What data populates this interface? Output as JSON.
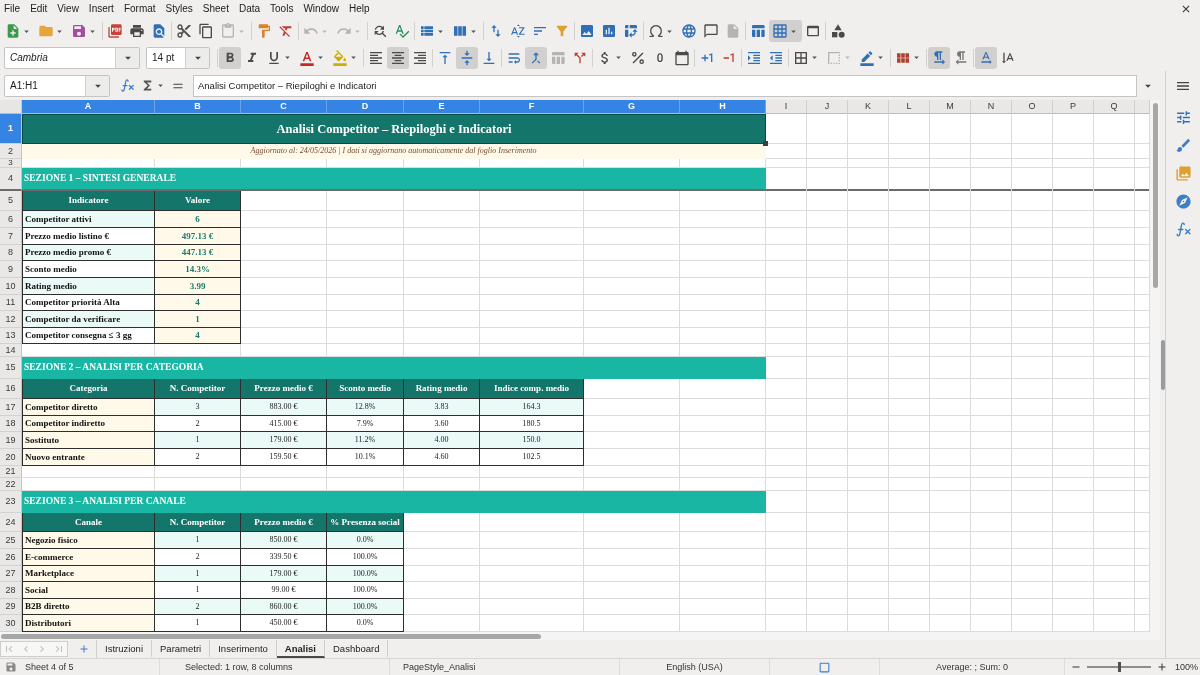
{
  "menu_bar": {
    "items": [
      "File",
      "Edit",
      "View",
      "Insert",
      "Format",
      "Styles",
      "Sheet",
      "Data",
      "Tools",
      "Window",
      "Help"
    ]
  },
  "standard_toolbar": [
    {
      "pressed": false,
      "disabled": false
    },
    {
      "pressed": false,
      "disabled": false
    },
    {
      "pressed": false,
      "disabled": false
    },
    {
      "pressed": false,
      "disabled": false
    },
    {
      "pressed": false,
      "disabled": false
    },
    {
      "pressed": false,
      "disabled": false
    },
    {
      "pressed": false,
      "disabled": false
    },
    {
      "pressed": false,
      "disabled": false
    },
    {
      "pressed": false,
      "disabled": true
    },
    {
      "pressed": false,
      "disabled": false
    },
    {
      "pressed": false,
      "disabled": false
    },
    {
      "pressed": false,
      "disabled": true
    },
    {
      "pressed": false,
      "disabled": true
    },
    {
      "pressed": false,
      "disabled": false
    },
    {
      "pressed": false,
      "disabled": false
    },
    {
      "pressed": false,
      "disabled": false
    },
    {
      "pressed": false,
      "disabled": false
    },
    {
      "pressed": false,
      "disabled": false
    },
    {
      "pressed": false,
      "disabled": false
    },
    {
      "pressed": false,
      "disabled": false
    },
    {
      "pressed": false,
      "disabled": false
    },
    {
      "pressed": false,
      "disabled": false
    },
    {
      "pressed": false,
      "disabled": false
    },
    {
      "pressed": false,
      "disabled": false
    },
    {
      "pressed": false,
      "disabled": false
    },
    {
      "pressed": false,
      "disabled": false
    },
    {
      "pressed": false,
      "disabled": false
    },
    {
      "pressed": false,
      "disabled": true
    },
    {
      "pressed": false,
      "disabled": false
    },
    {
      "pressed": true,
      "disabled": false
    },
    {
      "pressed": false,
      "disabled": false
    },
    {
      "pressed": false,
      "disabled": false
    }
  ],
  "formatting_toolbar": {
    "font_name": "Cambria",
    "font_size": "14 pt",
    "buttons": [
      {
        "pressed": true,
        "disabled": false
      },
      {
        "pressed": false,
        "disabled": false
      },
      {
        "pressed": false,
        "disabled": false
      },
      {
        "pressed": false,
        "disabled": false
      },
      {
        "pressed": false,
        "disabled": false
      },
      {
        "pressed": false,
        "disabled": false
      },
      {
        "pressed": true,
        "disabled": false
      },
      {
        "pressed": false,
        "disabled": false
      },
      {
        "pressed": false,
        "disabled": false
      },
      {
        "pressed": true,
        "disabled": false
      },
      {
        "pressed": false,
        "disabled": false
      },
      {
        "pressed": false,
        "disabled": false
      },
      {
        "pressed": true,
        "disabled": false
      },
      {
        "pressed": false,
        "disabled": true
      },
      {
        "pressed": false,
        "disabled": false
      },
      {
        "pressed": false,
        "disabled": false
      },
      {
        "pressed": false,
        "disabled": false
      },
      {
        "pressed": false,
        "disabled": false
      },
      {
        "pressed": false,
        "disabled": false
      },
      {
        "pressed": false,
        "disabled": false
      },
      {
        "pressed": false,
        "disabled": false
      },
      {
        "pressed": false,
        "disabled": false
      },
      {
        "pressed": false,
        "disabled": false
      },
      {
        "pressed": false,
        "disabled": false
      },
      {
        "pressed": false,
        "disabled": true
      },
      {
        "pressed": false,
        "disabled": false
      },
      {
        "pressed": false,
        "disabled": false
      },
      {
        "pressed": true,
        "disabled": false
      },
      {
        "pressed": false,
        "disabled": false
      },
      {
        "pressed": true,
        "disabled": false
      },
      {
        "pressed": false,
        "disabled": false
      }
    ]
  },
  "formula_bar": {
    "name_box": "A1:H1",
    "formula": "Analisi Competitor – Riepiloghi e Indicatori"
  },
  "sheet": {
    "column_headers": [
      {
        "label": "A",
        "selected": true
      },
      {
        "label": "B",
        "selected": true
      },
      {
        "label": "C",
        "selected": true
      },
      {
        "label": "D",
        "selected": true
      },
      {
        "label": "E",
        "selected": true
      },
      {
        "label": "F",
        "selected": true
      },
      {
        "label": "G",
        "selected": true
      },
      {
        "label": "H",
        "selected": true
      },
      {
        "label": "I",
        "selected": false
      },
      {
        "label": "J",
        "selected": false
      },
      {
        "label": "K",
        "selected": false
      },
      {
        "label": "L",
        "selected": false
      },
      {
        "label": "M",
        "selected": false
      },
      {
        "label": "N",
        "selected": false
      },
      {
        "label": "O",
        "selected": false
      },
      {
        "label": "P",
        "selected": false
      },
      {
        "label": "Q",
        "selected": false
      }
    ],
    "row_headers": [
      {
        "label": "1",
        "selected": true
      },
      {
        "label": "2",
        "selected": false
      },
      {
        "label": "3",
        "selected": false
      },
      {
        "label": "4",
        "selected": false
      },
      {
        "label": "5",
        "selected": false
      },
      {
        "label": "6",
        "selected": false
      },
      {
        "label": "7",
        "selected": false
      },
      {
        "label": "8",
        "selected": false
      },
      {
        "label": "9",
        "selected": false
      },
      {
        "label": "10",
        "selected": false
      },
      {
        "label": "11",
        "selected": false
      },
      {
        "label": "12",
        "selected": false
      },
      {
        "label": "13",
        "selected": false
      },
      {
        "label": "14",
        "selected": false
      },
      {
        "label": "15",
        "selected": false
      },
      {
        "label": "16",
        "selected": false
      },
      {
        "label": "17",
        "selected": false
      },
      {
        "label": "18",
        "selected": false
      },
      {
        "label": "19",
        "selected": false
      },
      {
        "label": "20",
        "selected": false
      },
      {
        "label": "21",
        "selected": false
      },
      {
        "label": "22",
        "selected": false
      },
      {
        "label": "23",
        "selected": false
      },
      {
        "label": "24",
        "selected": false
      },
      {
        "label": "25",
        "selected": false
      },
      {
        "label": "26",
        "selected": false
      },
      {
        "label": "27",
        "selected": false
      },
      {
        "label": "28",
        "selected": false
      },
      {
        "label": "29",
        "selected": false
      },
      {
        "label": "30",
        "selected": false
      }
    ],
    "title": "Analisi Competitor – Riepiloghi e Indicatori",
    "subtitle": "Aggiornato al: 24/05/2026 | I dati si aggiornano automaticamente dal foglio Inserimento",
    "sections": [
      {
        "kind": "summary",
        "title": "SEZIONE 1 – SINTESI GENERALE",
        "columns": [
          "Indicatore",
          "Valore"
        ],
        "rows": [
          [
            "Competitor attivi",
            "6"
          ],
          [
            "Prezzo medio listino €",
            "497.13 €"
          ],
          [
            "Prezzo medio promo €",
            "447.13 €"
          ],
          [
            "Sconto medio",
            "14.3%"
          ],
          [
            "Rating medio",
            "3.99"
          ],
          [
            "Competitor priorità Alta",
            "4"
          ],
          [
            "Competitor da verificare",
            "1"
          ],
          [
            "Competitor consegna ≤ 3 gg",
            "4"
          ]
        ]
      },
      {
        "kind": "breakdown",
        "title": "SEZIONE 2 – ANALISI PER CATEGORIA",
        "columns": [
          "Categoria",
          "N. Competitor",
          "Prezzo medio €",
          "Sconto medio",
          "Rating medio",
          "Indice comp. medio"
        ],
        "rows": [
          [
            "Competitor diretto",
            "3",
            "883.00 €",
            "12.8%",
            "3.83",
            "164.3"
          ],
          [
            "Competitor indiretto",
            "2",
            "415.00 €",
            "7.9%",
            "3.60",
            "180.5"
          ],
          [
            "Sostituto",
            "1",
            "179.00 €",
            "11.2%",
            "4.00",
            "150.0"
          ],
          [
            "Nuovo entrante",
            "2",
            "159.50 €",
            "10.1%",
            "4.60",
            "102.5"
          ]
        ]
      },
      {
        "kind": "breakdown",
        "title": "SEZIONE 3 – ANALISI PER CANALE",
        "columns": [
          "Canale",
          "N. Competitor",
          "Prezzo medio €",
          "% Presenza social"
        ],
        "rows": [
          [
            "Negozio fisico",
            "1",
            "850.00 €",
            "0.0%"
          ],
          [
            "E-commerce",
            "2",
            "339.50 €",
            "100.0%"
          ],
          [
            "Marketplace",
            "1",
            "179.00 €",
            "100.0%"
          ],
          [
            "Social",
            "1",
            "99.00 €",
            "100.0%"
          ],
          [
            "B2B diretto",
            "2",
            "860.00 €",
            "100.0%"
          ],
          [
            "Distributori",
            "1",
            "450.00 €",
            "0.0%"
          ]
        ]
      }
    ]
  },
  "tab_navigation": [
    {
      "disabled": true
    },
    {
      "disabled": true
    },
    {
      "disabled": true
    },
    {
      "disabled": true
    }
  ],
  "sheet_tabs": [
    {
      "label": "Istruzioni",
      "selected": false
    },
    {
      "label": "Parametri",
      "selected": false
    },
    {
      "label": "Inserimento",
      "selected": false
    },
    {
      "label": "Analisi",
      "selected": true
    },
    {
      "label": "Dashboard",
      "selected": false
    }
  ],
  "status_bar": {
    "sheet": "Sheet 4 of 5",
    "selection": "Selected: 1 row, 8 columns",
    "page_style": "PageStyle_Analisi",
    "language": "English (USA)",
    "summary": "Average: ; Sum: 0",
    "zoom": {
      "level": 0.5,
      "reading": "100%"
    }
  }
}
